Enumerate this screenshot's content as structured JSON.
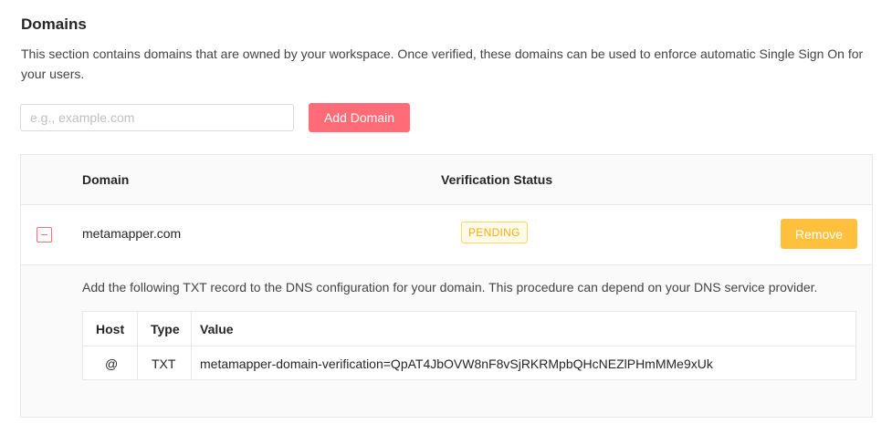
{
  "section": {
    "title": "Domains",
    "description": "This section contains domains that are owned by your workspace. Once verified, these domains can be used to enforce automatic Single Sign On for your users."
  },
  "add_form": {
    "input_value": "",
    "input_placeholder": "e.g., example.com",
    "button_label": "Add Domain"
  },
  "colors": {
    "accent": "#ff6b77",
    "remove": "#ffc13d",
    "pending_text": "#faad14",
    "pending_bg": "#fffbe6",
    "pending_border": "#ffd666"
  },
  "domains_table": {
    "headers": {
      "domain": "Domain",
      "status": "Verification Status"
    },
    "rows": [
      {
        "expand_icon": "minus-square-icon",
        "domain": "metamapper.com",
        "status": "PENDING",
        "action_label": "Remove",
        "expanded": {
          "instructions": "Add the following TXT record to the DNS configuration for your domain. This procedure can depend on your DNS service provider.",
          "record_headers": {
            "host": "Host",
            "type": "Type",
            "value": "Value"
          },
          "records": [
            {
              "host": "@",
              "type": "TXT",
              "value": "metamapper-domain-verification=QpAT4JbOVW8nF8vSjRKRMpbQHcNEZlPHmMMe9xUk"
            }
          ]
        }
      }
    ]
  }
}
